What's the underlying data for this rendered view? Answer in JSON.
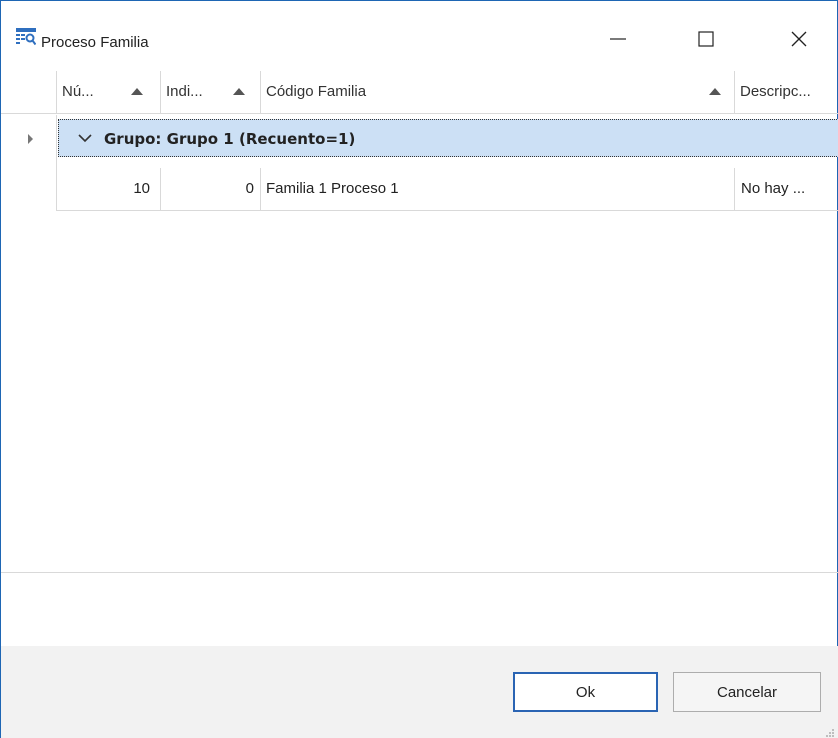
{
  "window": {
    "title": "Proceso Familia",
    "icon": "grid-search-icon"
  },
  "controls": {
    "minimize": "minimize-icon",
    "maximize": "maximize-icon",
    "close": "close-icon"
  },
  "grid": {
    "columns": [
      {
        "label": "Nú...",
        "sorted": "ascending"
      },
      {
        "label": "Indi...",
        "sorted": "ascending"
      },
      {
        "label": "Código Familia",
        "sorted": "ascending"
      },
      {
        "label": "Descripc..."
      }
    ],
    "group": {
      "text": "Grupo: Grupo 1 (Recuento=1)",
      "expanded": true
    },
    "rows": [
      {
        "numero": "10",
        "indice": "0",
        "codigo": "Familia 1 Proceso 1",
        "descripcion": "No hay ..."
      }
    ]
  },
  "footer": {
    "ok_label": "Ok",
    "cancel_label": "Cancelar"
  },
  "colors": {
    "accent": "#1e66b4",
    "group_background": "#cce0f5",
    "footer_background": "#f2f2f2"
  }
}
